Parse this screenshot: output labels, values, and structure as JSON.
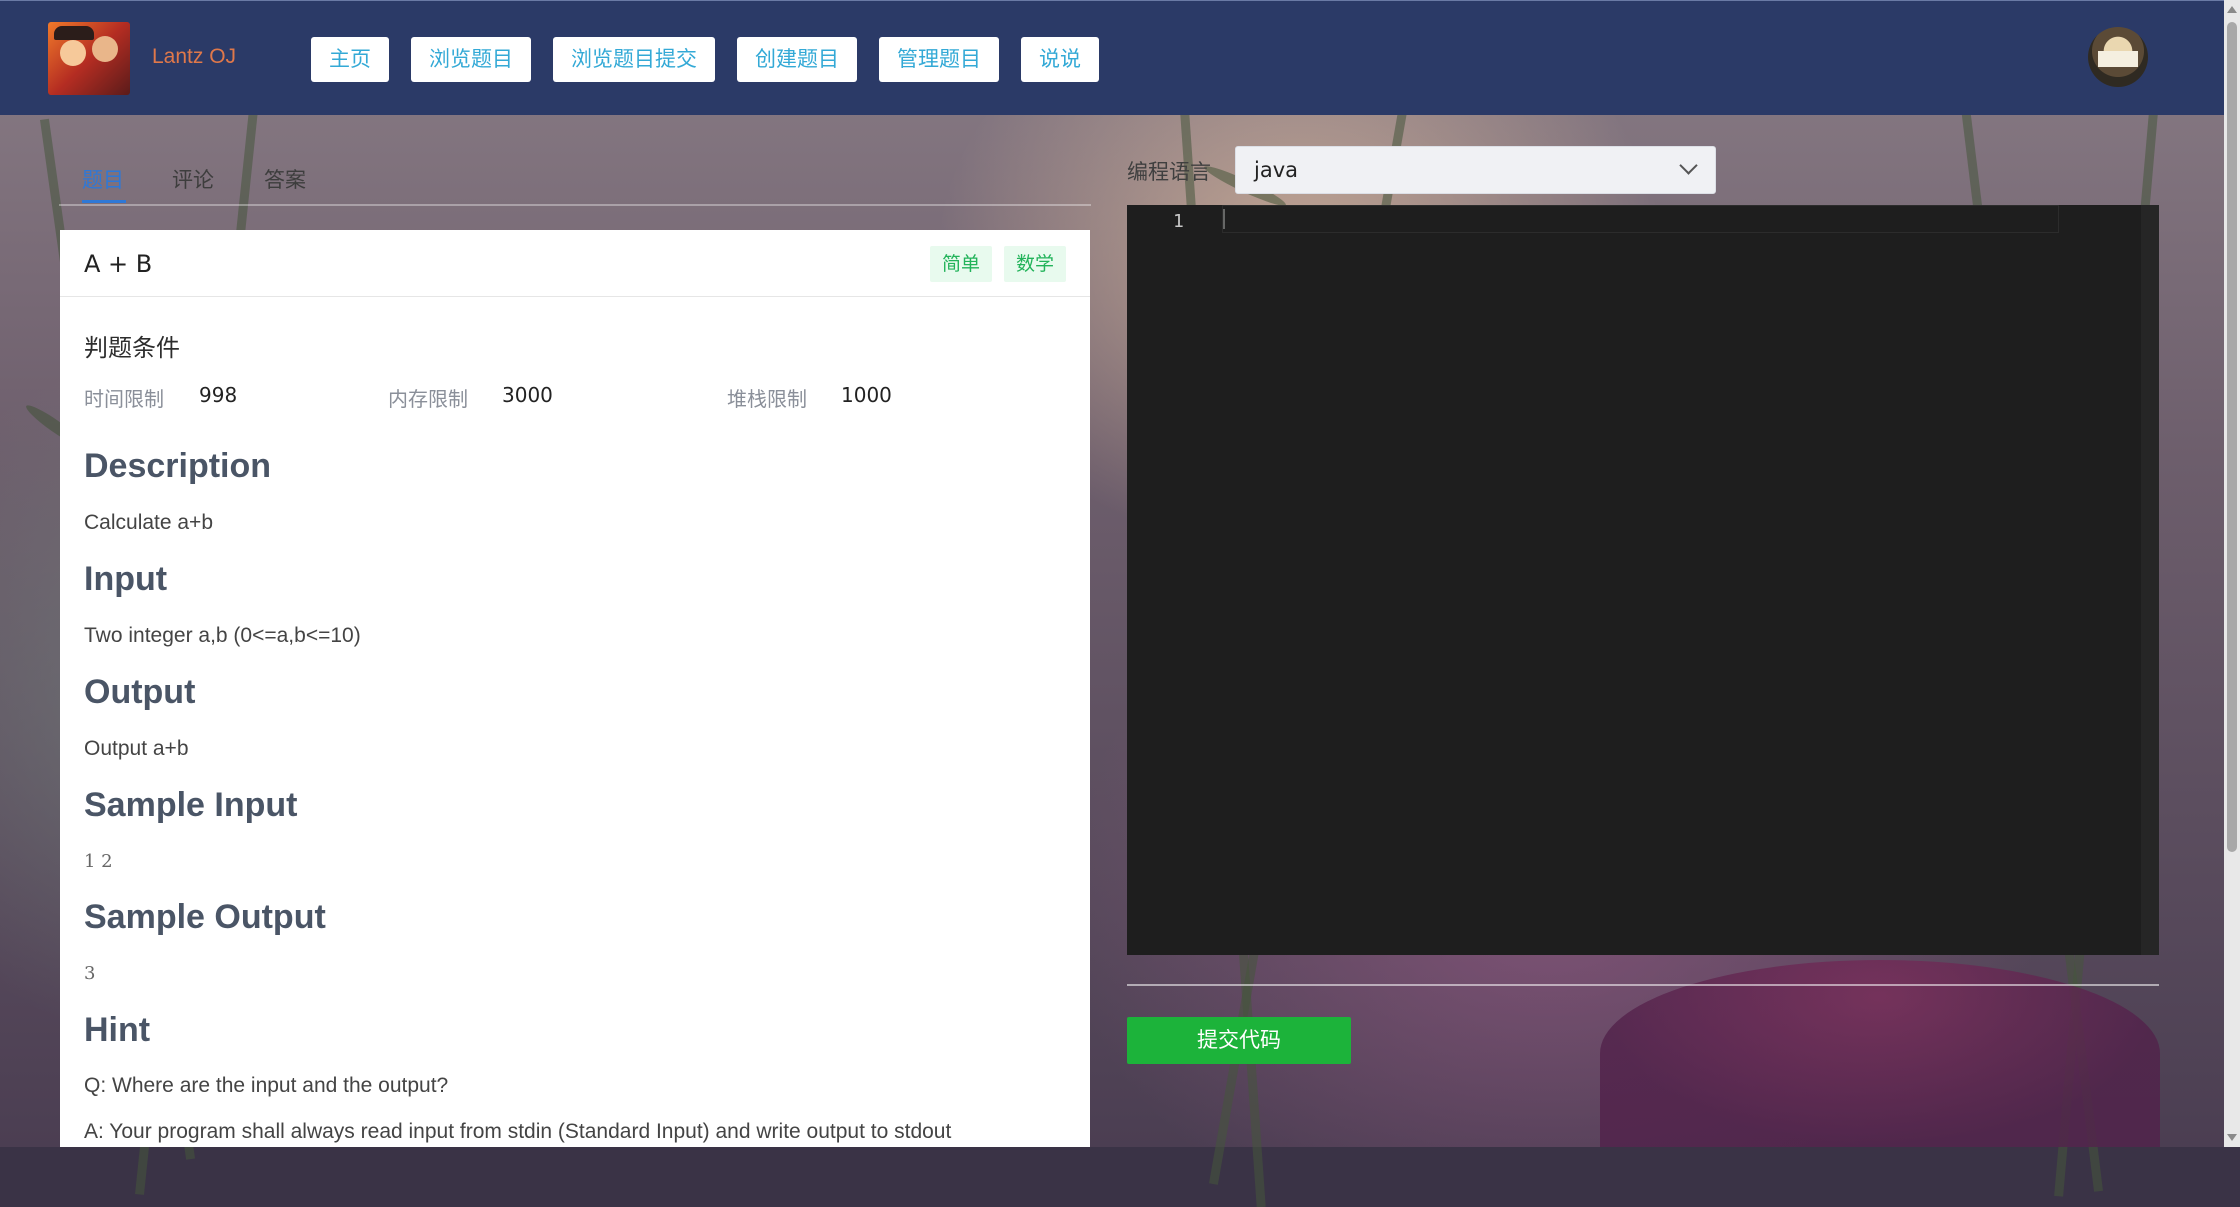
{
  "header": {
    "brand": "Lantz OJ",
    "nav": [
      "主页",
      "浏览题目",
      "浏览题目提交",
      "创建题目",
      "管理题目",
      "说说"
    ]
  },
  "tabs": [
    "题目",
    "评论",
    "答案"
  ],
  "problem": {
    "title": "A + B",
    "tags": [
      "简单",
      "数学"
    ],
    "judge_title": "判题条件",
    "limits": [
      {
        "label": "时间限制",
        "value": "998"
      },
      {
        "label": "内存限制",
        "value": "3000"
      },
      {
        "label": "堆栈限制",
        "value": "1000"
      }
    ],
    "sections": {
      "description_h": "Description",
      "description": "Calculate a+b",
      "input_h": "Input",
      "input": "Two integer a,b (0<=a,b<=10)",
      "output_h": "Output",
      "output": "Output a+b",
      "sample_input_h": "Sample Input",
      "sample_input": "1 2",
      "sample_output_h": "Sample Output",
      "sample_output": "3",
      "hint_h": "Hint",
      "hint_q": "Q: Where are the input and the output?",
      "hint_a": "A: Your program shall always read input from stdin (Standard Input) and write output to stdout"
    }
  },
  "editor": {
    "language_label": "编程语言",
    "language": "java",
    "line_numbers": [
      "1"
    ],
    "submit_label": "提交代码"
  },
  "colors": {
    "topbar": "#2b3a67",
    "accent": "#2f78d6",
    "nav_text": "#33a9d6",
    "brand": "#e0784a",
    "tag_green": "#22b35a",
    "submit": "#1cb33a",
    "editor_bg": "#1e1e1e"
  }
}
